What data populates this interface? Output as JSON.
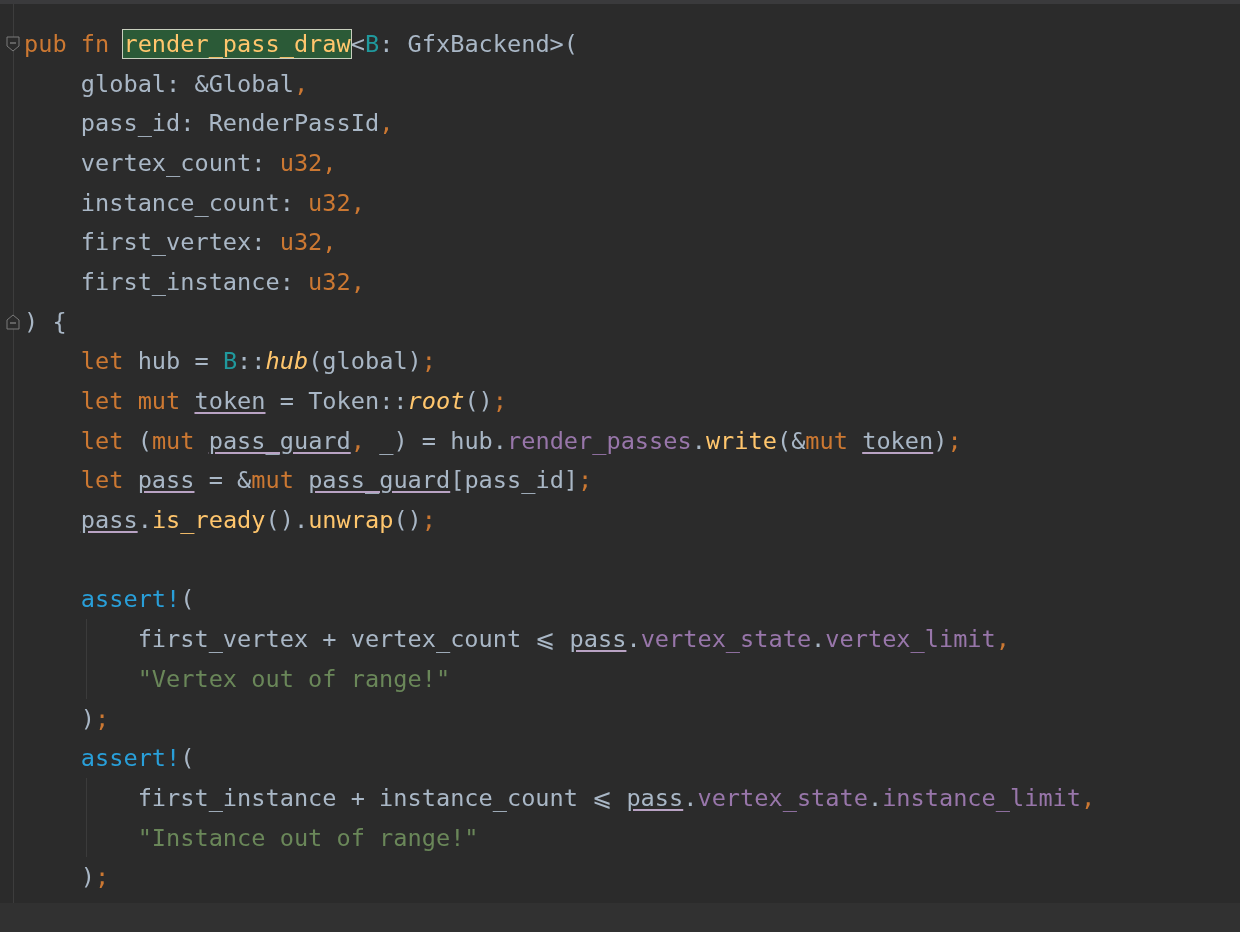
{
  "editor": {
    "lines": [
      {
        "kind": "code",
        "fold_start": true,
        "tokens": [
          {
            "text": "pub fn ",
            "kind": "keyword"
          },
          {
            "text": "render_pass_draw",
            "kind": "highlight"
          },
          {
            "text": "<",
            "kind": "plain"
          },
          {
            "text": "B",
            "kind": "generic"
          },
          {
            "text": ": GfxBackend>(",
            "kind": "plain"
          }
        ]
      },
      {
        "kind": "code",
        "tokens": [
          {
            "text": "    global: &Global",
            "kind": "plain"
          },
          {
            "text": ",",
            "kind": "punct"
          }
        ]
      },
      {
        "kind": "code",
        "tokens": [
          {
            "text": "    pass_id: RenderPassId",
            "kind": "plain"
          },
          {
            "text": ",",
            "kind": "punct"
          }
        ]
      },
      {
        "kind": "code",
        "tokens": [
          {
            "text": "    vertex_count: ",
            "kind": "plain"
          },
          {
            "text": "u32,",
            "kind": "keyword"
          }
        ]
      },
      {
        "kind": "code",
        "tokens": [
          {
            "text": "    instance_count: ",
            "kind": "plain"
          },
          {
            "text": "u32,",
            "kind": "keyword"
          }
        ]
      },
      {
        "kind": "code",
        "tokens": [
          {
            "text": "    first_vertex: ",
            "kind": "plain"
          },
          {
            "text": "u32,",
            "kind": "keyword"
          }
        ]
      },
      {
        "kind": "code",
        "tokens": [
          {
            "text": "    first_instance: ",
            "kind": "plain"
          },
          {
            "text": "u32,",
            "kind": "keyword"
          }
        ]
      },
      {
        "kind": "code",
        "fold_end": true,
        "tokens": [
          {
            "text": ") {",
            "kind": "plain"
          }
        ]
      },
      {
        "kind": "code",
        "tokens": [
          {
            "text": "    let ",
            "kind": "keyword"
          },
          {
            "text": "hub = ",
            "kind": "plain"
          },
          {
            "text": "B",
            "kind": "generic"
          },
          {
            "text": "::",
            "kind": "plain"
          },
          {
            "text": "hub",
            "kind": "call"
          },
          {
            "text": "(global)",
            "kind": "plain"
          },
          {
            "text": ";",
            "kind": "punct"
          }
        ]
      },
      {
        "kind": "code",
        "tokens": [
          {
            "text": "    let mut ",
            "kind": "keyword"
          },
          {
            "text": "token",
            "kind": "var"
          },
          {
            "text": " = Token::",
            "kind": "plain"
          },
          {
            "text": "root",
            "kind": "call"
          },
          {
            "text": "()",
            "kind": "plain"
          },
          {
            "text": ";",
            "kind": "punct"
          }
        ]
      },
      {
        "kind": "code",
        "tokens": [
          {
            "text": "    let ",
            "kind": "keyword"
          },
          {
            "text": "(",
            "kind": "plain"
          },
          {
            "text": "mut ",
            "kind": "keyword"
          },
          {
            "text": "pass_guard",
            "kind": "var"
          },
          {
            "text": ", ",
            "kind": "punct"
          },
          {
            "text": "_) = hub.",
            "kind": "plain"
          },
          {
            "text": "render_passes",
            "kind": "field"
          },
          {
            "text": ".",
            "kind": "plain"
          },
          {
            "text": "write",
            "kind": "method"
          },
          {
            "text": "(&",
            "kind": "plain"
          },
          {
            "text": "mut ",
            "kind": "keyword"
          },
          {
            "text": "token",
            "kind": "var"
          },
          {
            "text": ")",
            "kind": "plain"
          },
          {
            "text": ";",
            "kind": "punct"
          }
        ]
      },
      {
        "kind": "code",
        "tokens": [
          {
            "text": "    let ",
            "kind": "keyword"
          },
          {
            "text": "pass",
            "kind": "var"
          },
          {
            "text": " = &",
            "kind": "plain"
          },
          {
            "text": "mut ",
            "kind": "keyword"
          },
          {
            "text": "pass_guard",
            "kind": "var"
          },
          {
            "text": "[pass_id]",
            "kind": "plain"
          },
          {
            "text": ";",
            "kind": "punct"
          }
        ]
      },
      {
        "kind": "code",
        "tokens": [
          {
            "text": "    pass",
            "kind": "var"
          },
          {
            "text": ".",
            "kind": "plain"
          },
          {
            "text": "is_ready",
            "kind": "method"
          },
          {
            "text": "().",
            "kind": "plain"
          },
          {
            "text": "unwrap",
            "kind": "method"
          },
          {
            "text": "()",
            "kind": "plain"
          },
          {
            "text": ";",
            "kind": "punct"
          }
        ]
      },
      {
        "kind": "blank"
      },
      {
        "kind": "code",
        "tokens": [
          {
            "text": "    assert!",
            "kind": "macro"
          },
          {
            "text": "(",
            "kind": "plain"
          }
        ]
      },
      {
        "kind": "code",
        "guide": true,
        "tokens": [
          {
            "text": "        first_vertex + vertex_count ⩽ ",
            "kind": "plain"
          },
          {
            "text": "pass",
            "kind": "var"
          },
          {
            "text": ".",
            "kind": "plain"
          },
          {
            "text": "vertex_state",
            "kind": "field"
          },
          {
            "text": ".",
            "kind": "plain"
          },
          {
            "text": "vertex_limit",
            "kind": "field"
          },
          {
            "text": ",",
            "kind": "punct"
          }
        ]
      },
      {
        "kind": "code",
        "guide": true,
        "tokens": [
          {
            "text": "        \"Vertex out of range!\"",
            "kind": "string"
          }
        ]
      },
      {
        "kind": "code",
        "tokens": [
          {
            "text": "    )",
            "kind": "plain"
          },
          {
            "text": ";",
            "kind": "punct"
          }
        ]
      },
      {
        "kind": "code",
        "tokens": [
          {
            "text": "    assert!",
            "kind": "macro"
          },
          {
            "text": "(",
            "kind": "plain"
          }
        ]
      },
      {
        "kind": "code",
        "guide": true,
        "tokens": [
          {
            "text": "        first_instance + instance_count ⩽ ",
            "kind": "plain"
          },
          {
            "text": "pass",
            "kind": "var"
          },
          {
            "text": ".",
            "kind": "plain"
          },
          {
            "text": "vertex_state",
            "kind": "field"
          },
          {
            "text": ".",
            "kind": "plain"
          },
          {
            "text": "instance_limit",
            "kind": "field"
          },
          {
            "text": ",",
            "kind": "punct"
          }
        ]
      },
      {
        "kind": "code",
        "guide": true,
        "tokens": [
          {
            "text": "        \"Instance out of range!\"",
            "kind": "string"
          }
        ]
      },
      {
        "kind": "code",
        "tokens": [
          {
            "text": "    )",
            "kind": "plain"
          },
          {
            "text": ";",
            "kind": "punct"
          }
        ]
      }
    ]
  }
}
